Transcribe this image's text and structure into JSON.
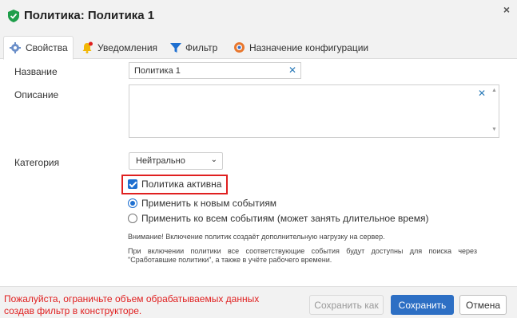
{
  "dialog": {
    "title": "Политика: Политика 1",
    "close_label": "×"
  },
  "tabs": [
    {
      "label": "Свойства",
      "icon": "gear-users-icon",
      "active": true
    },
    {
      "label": "Уведомления",
      "icon": "bell-icon",
      "active": false
    },
    {
      "label": "Фильтр",
      "icon": "filter-icon",
      "active": false
    },
    {
      "label": "Назначение конфигурации",
      "icon": "config-icon",
      "active": false
    }
  ],
  "form": {
    "name_label": "Название",
    "name_value": "Политика 1",
    "description_label": "Описание",
    "description_value": "",
    "category_label": "Категория",
    "category_value": "Нейтрально",
    "active_label": "Политика активна",
    "active_checked": true,
    "apply_new_label": "Применить к новым событиям",
    "apply_all_label": "Применить ко всем событиям (может занять длительное время)",
    "warning_note": "Внимание! Включение политик создаёт дополнительную нагрузку на сервер.",
    "info_note": "При включении политики все соответствующие события будут доступны для поиска через \"Сработавшие политики\", а также в учёте рабочего времени."
  },
  "footer": {
    "warning": "Пожалуйста, ограничьте объем обрабатываемых данных создав фильтр в конструкторе.",
    "save_as_label": "Сохранить как",
    "save_label": "Сохранить",
    "cancel_label": "Отмена"
  },
  "colors": {
    "accent": "#2d6fc4",
    "warning_red": "#e02020",
    "title_icon_green": "#1e9e4a"
  }
}
